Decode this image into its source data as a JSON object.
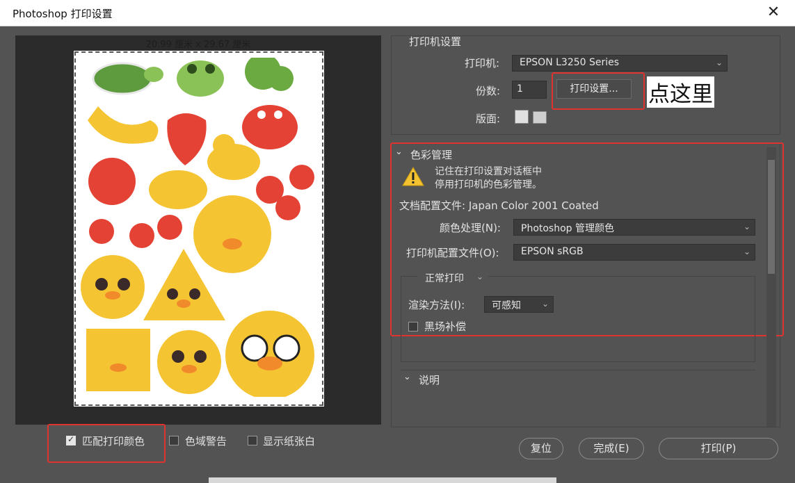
{
  "window": {
    "title": "Photoshop 打印设置",
    "close_glyph": "✕"
  },
  "preview": {
    "dims_text": "20.99 厘米 x 29.67 厘米"
  },
  "printer_section": {
    "heading": "打印机设置",
    "printer_label": "打印机:",
    "printer_value": "EPSON L3250 Series",
    "copies_label": "份数:",
    "copies_value": "1",
    "print_settings_button": "打印设置...",
    "layout_label": "版面:"
  },
  "annotation": "点这里",
  "color_section": {
    "heading": "色彩管理",
    "warning_line1": "记住在打印设置对话框中",
    "warning_line2": "停用打印机的色彩管理。",
    "doc_profile": "文档配置文件: Japan Color 2001 Coated",
    "color_handling_label": "颜色处理(N):",
    "color_handling_value": "Photoshop 管理颜色",
    "printer_profile_label": "打印机配置文件(O):",
    "printer_profile_value": "EPSON  sRGB",
    "print_mode": "正常打印",
    "render_label": "渲染方法(I):",
    "render_value": "可感知",
    "black_point": "黑场补偿"
  },
  "description_section": {
    "heading": "说明"
  },
  "bottom": {
    "match_colors": "匹配打印颜色",
    "gamut_warning": "色域警告",
    "show_paper_white": "显示纸张白",
    "reset_button": "复位",
    "done_button": "完成(E)",
    "print_button": "打印(P)"
  },
  "colors": {
    "highlight": "#e0322e",
    "panel": "#535353",
    "preview_bg": "#2b2b2b"
  }
}
